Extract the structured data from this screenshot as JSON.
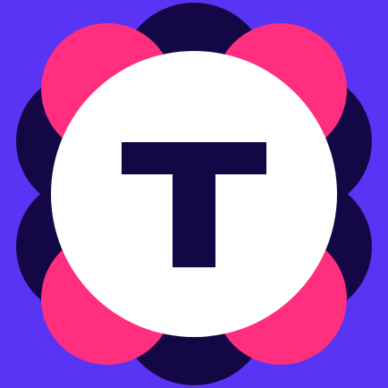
{
  "app_icon": {
    "name": "flower-logo",
    "letter": "T",
    "colors": {
      "background": "#5a34f5",
      "navy": "#140746",
      "pink": "#ff2e7e",
      "center": "#ffffff",
      "letter": "#140746"
    }
  }
}
